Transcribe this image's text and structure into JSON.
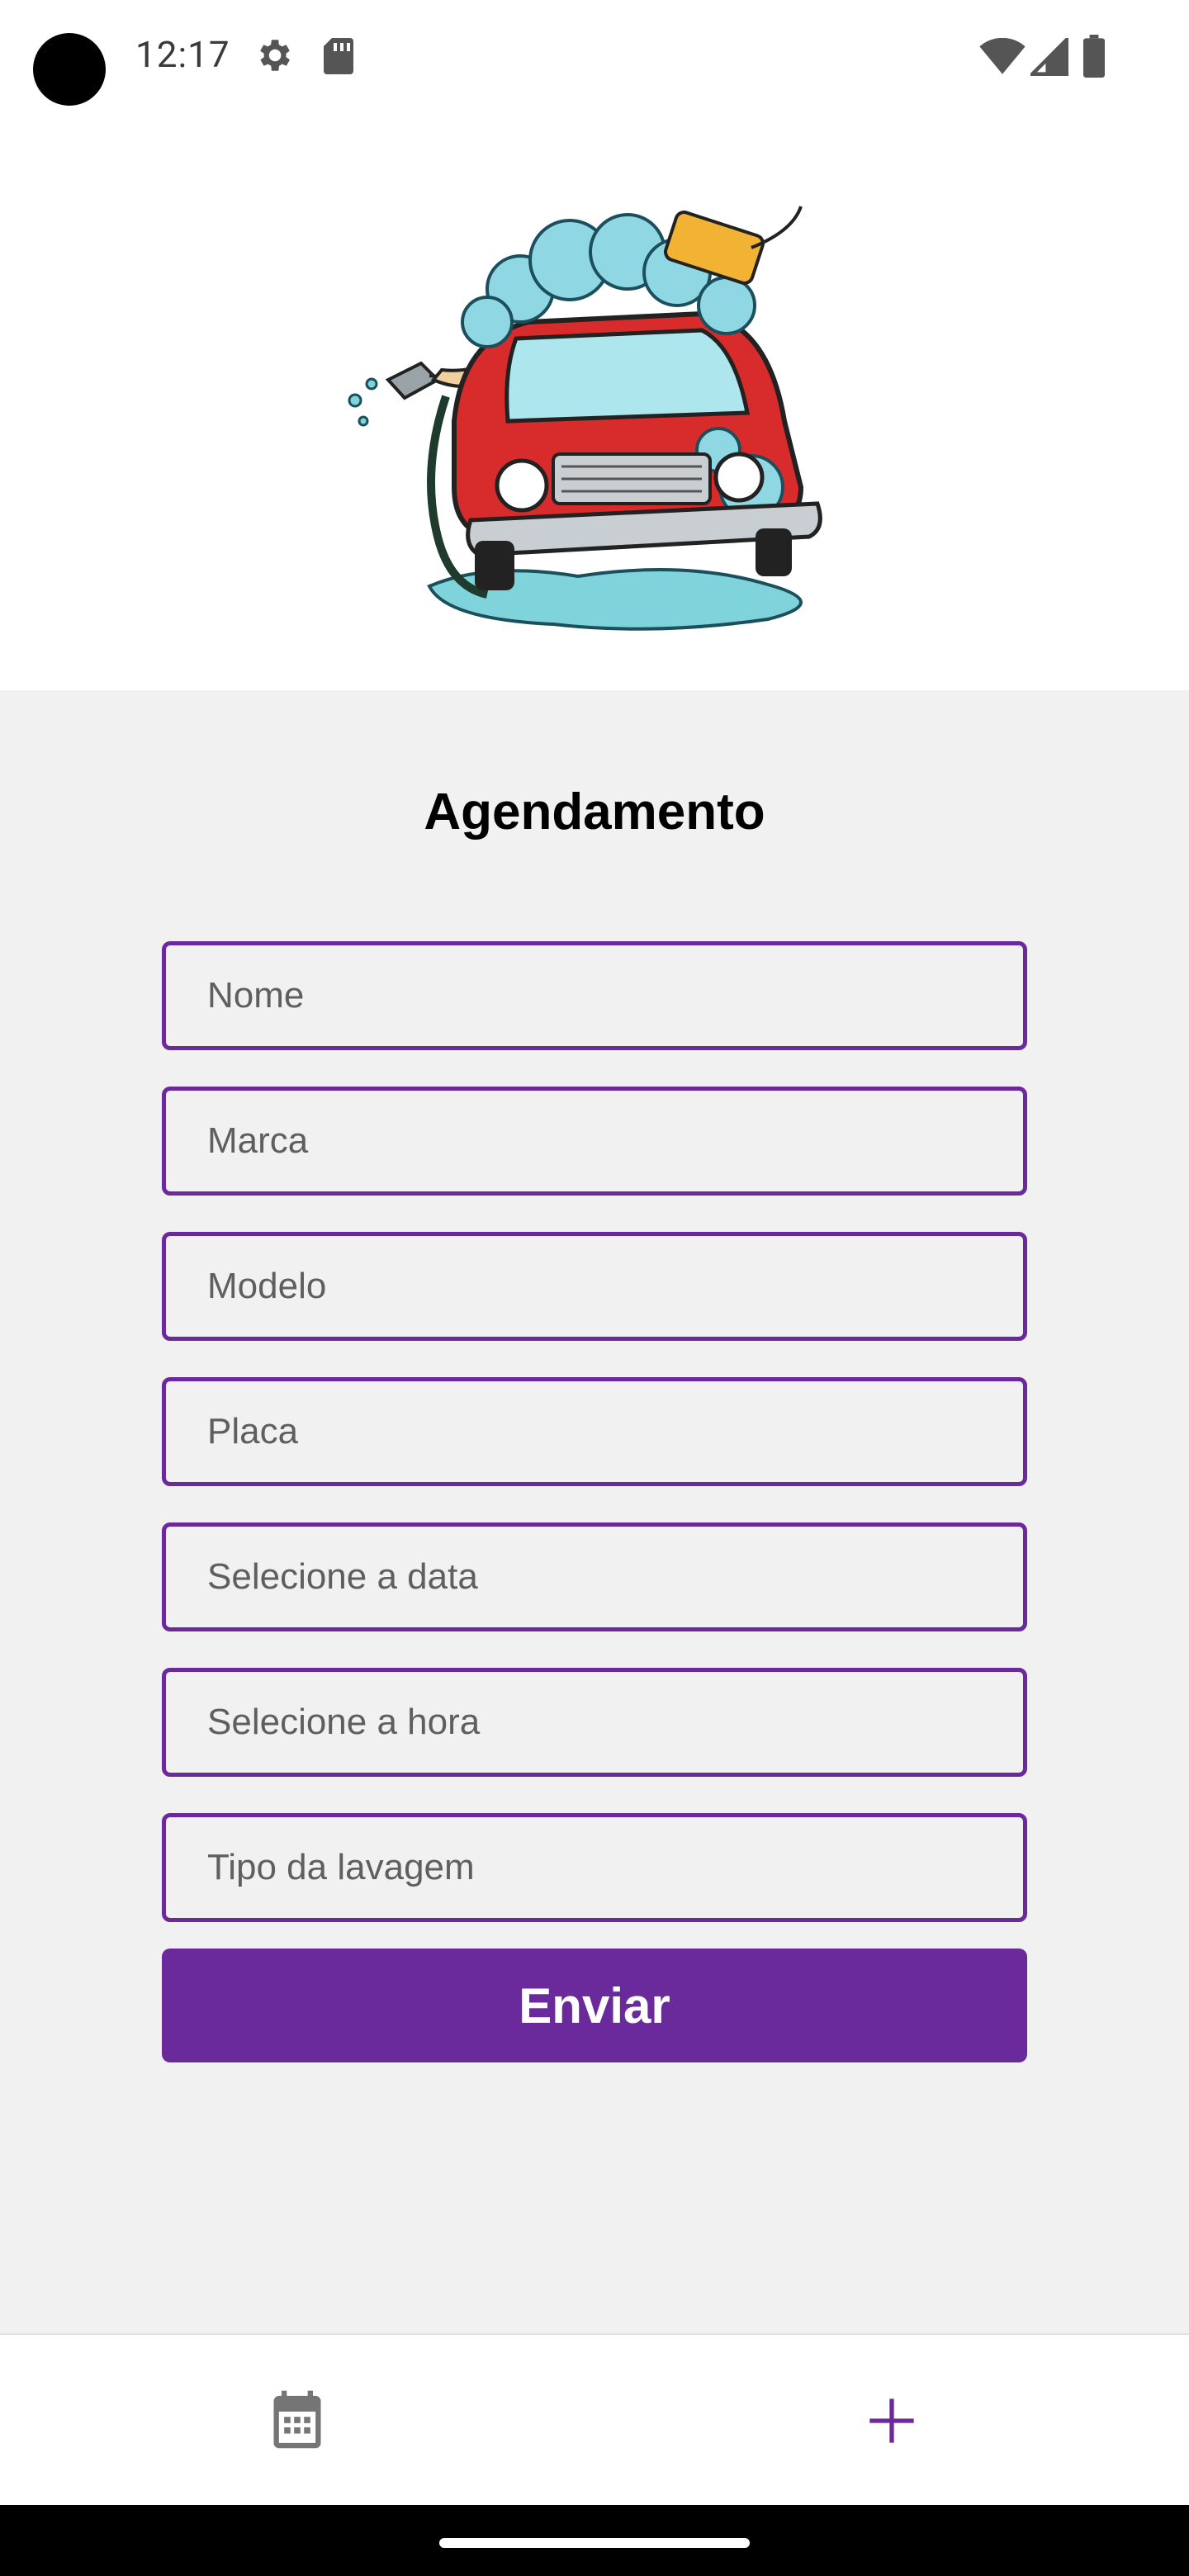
{
  "status_bar": {
    "time": "12:17",
    "icons": [
      "settings-icon",
      "sd-card-icon",
      "wifi-icon",
      "cell-signal-icon",
      "battery-icon"
    ]
  },
  "hero": {
    "image": "car-wash-illustration"
  },
  "form": {
    "title": "Agendamento",
    "fields": [
      {
        "placeholder": "Nome",
        "value": ""
      },
      {
        "placeholder": "Marca",
        "value": ""
      },
      {
        "placeholder": "Modelo",
        "value": ""
      },
      {
        "placeholder": "Placa",
        "value": ""
      },
      {
        "placeholder": "Selecione a data",
        "value": ""
      },
      {
        "placeholder": "Selecione a hora",
        "value": ""
      },
      {
        "placeholder": "Tipo da lavagem",
        "value": ""
      }
    ],
    "submit_label": "Enviar"
  },
  "bottom_nav": {
    "items": [
      {
        "icon": "calendar-icon",
        "selected": false
      },
      {
        "icon": "add-icon",
        "selected": true
      }
    ]
  },
  "colors": {
    "accent": "#6a2a9b",
    "background": "#f1f1f1",
    "surface": "#ffffff",
    "inactive_icon": "#757575"
  }
}
